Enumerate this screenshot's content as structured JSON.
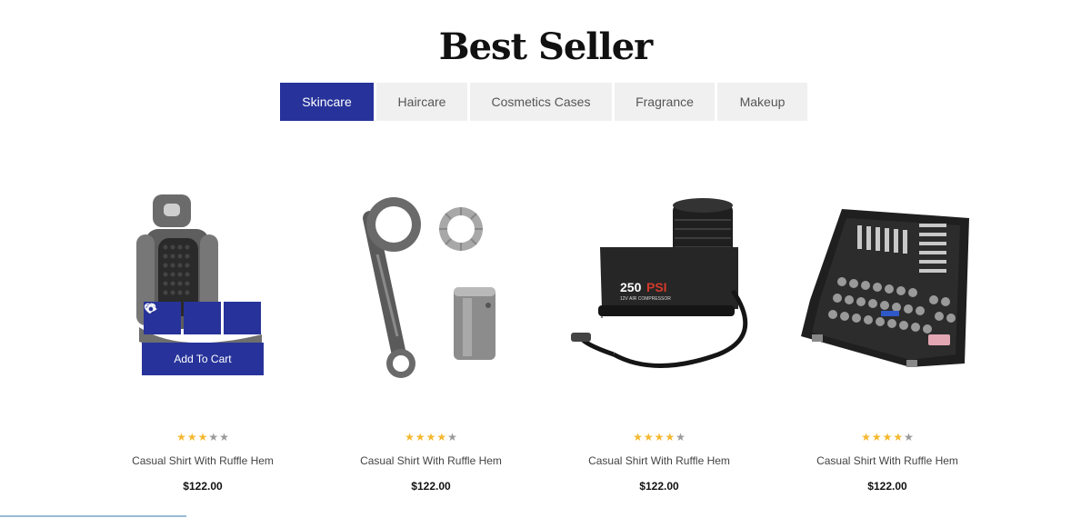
{
  "section": {
    "title": "Best Seller"
  },
  "tabs": [
    {
      "label": "Skincare",
      "active": true
    },
    {
      "label": "Haircare",
      "active": false
    },
    {
      "label": "Cosmetics Cases",
      "active": false
    },
    {
      "label": "Fragrance",
      "active": false
    },
    {
      "label": "Makeup",
      "active": false
    }
  ],
  "accent_color": "#27339a",
  "star_color": "#f5b82e",
  "card_actions": {
    "icons": [
      "heart-icon",
      "compare-arrows-icon",
      "eye-icon"
    ],
    "add_to_cart_label": "Add To Cart"
  },
  "products": [
    {
      "image": "car-seat",
      "rating": 3,
      "max_rating": 5,
      "name": "Casual Shirt With Ruffle Hem",
      "price": "$122.00"
    },
    {
      "image": "connecting-rod",
      "rating": 4,
      "max_rating": 5,
      "name": "Casual Shirt With Ruffle Hem",
      "price": "$122.00"
    },
    {
      "image": "air-compressor",
      "rating": 4,
      "max_rating": 5,
      "name": "Casual Shirt With Ruffle Hem",
      "price": "$122.00"
    },
    {
      "image": "tool-set-case",
      "rating": 4,
      "max_rating": 5,
      "name": "Casual Shirt With Ruffle Hem",
      "price": "$122.00"
    }
  ],
  "compressor_badge": {
    "big": "250",
    "accent": "PSI",
    "small": "12V AIR COMPRESSOR"
  }
}
